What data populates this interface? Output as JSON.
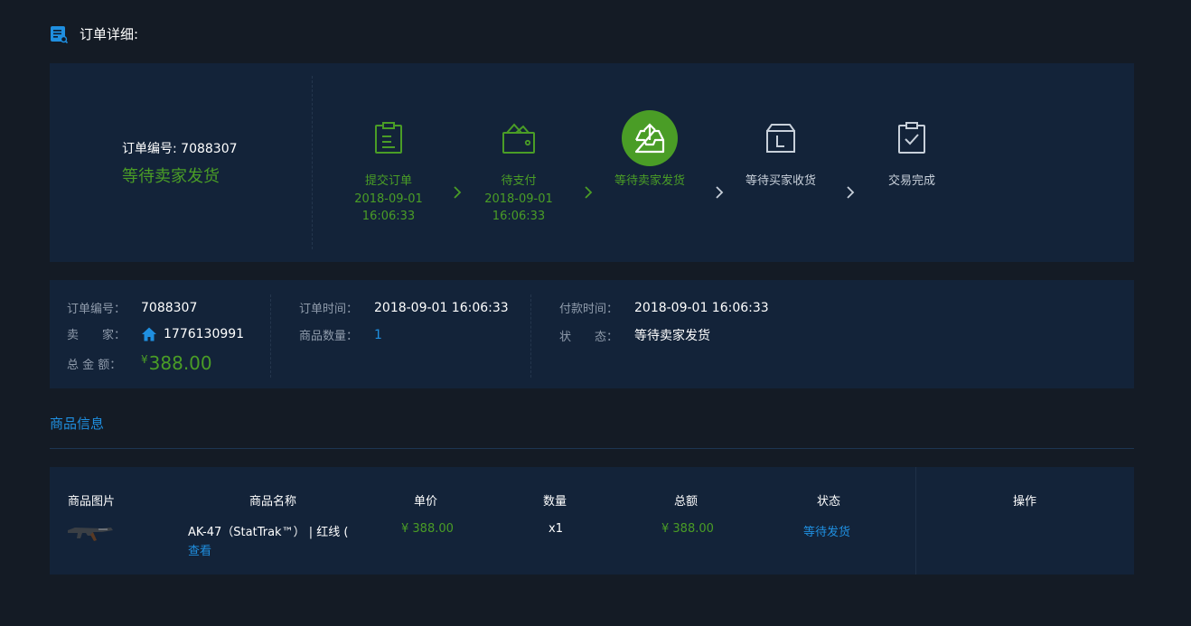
{
  "header": {
    "title": "订单详细:",
    "icon": "order-detail-icon"
  },
  "summary": {
    "order_no_line": "订单编号: 7088307",
    "status": "等待卖家发货"
  },
  "steps": [
    {
      "label": "提交订单",
      "date": "2018-09-01",
      "time": "16:06:33",
      "icon": "clipboard-icon"
    },
    {
      "label": "待支付",
      "date": "2018-09-01",
      "time": "16:06:33",
      "icon": "wallet-icon"
    },
    {
      "label": "等待卖家发货",
      "icon": "tray-upload-icon"
    },
    {
      "label": "等待买家收货",
      "icon": "box-icon"
    },
    {
      "label": "交易完成",
      "icon": "clipboard-check-icon"
    }
  ],
  "info": {
    "order_no_label": "订单编号：",
    "order_no": "7088307",
    "seller_label": "卖　　家：",
    "seller": "1776130991",
    "total_label": "总 金 额：",
    "total_symbol": "¥",
    "total": "388.00",
    "order_time_label": "订单时间：",
    "order_time": "2018-09-01 16:06:33",
    "qty_label": "商品数量：",
    "qty": "1",
    "pay_time_label": "付款时间：",
    "pay_time": "2018-09-01 16:06:33",
    "state_label": "状　　态：",
    "state": "等待卖家发货"
  },
  "goods": {
    "section_title": "商品信息",
    "columns": [
      "商品图片",
      "商品名称",
      "单价",
      "数量",
      "总额",
      "状态",
      "操作"
    ],
    "row": {
      "name": "AK-47（StatTrak™） | 红线 (",
      "view": "查看",
      "price": "¥ 388.00",
      "qty": "x1",
      "total": "¥ 388.00",
      "status": "等待发货"
    }
  },
  "colors": {
    "accent_green": "#4a9d26",
    "accent_blue": "#1f8fe0",
    "panel_bg": "#132339",
    "page_bg": "#141b25"
  }
}
